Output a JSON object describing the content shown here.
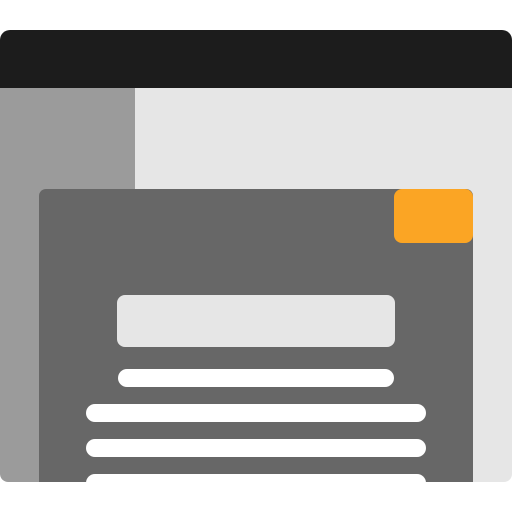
{
  "window": {
    "titlebar": {},
    "sidebar": {},
    "content": {}
  },
  "dialog": {
    "action_button": {
      "color": "#fba524"
    },
    "heading_block": {},
    "text_lines": [
      {},
      {},
      {},
      {}
    ]
  },
  "colors": {
    "titlebar": "#1c1c1c",
    "content_background": "#e6e6e6",
    "sidebar": "#9b9b9b",
    "dialog": "#676767",
    "accent": "#fba524",
    "text_line": "#ffffff"
  }
}
